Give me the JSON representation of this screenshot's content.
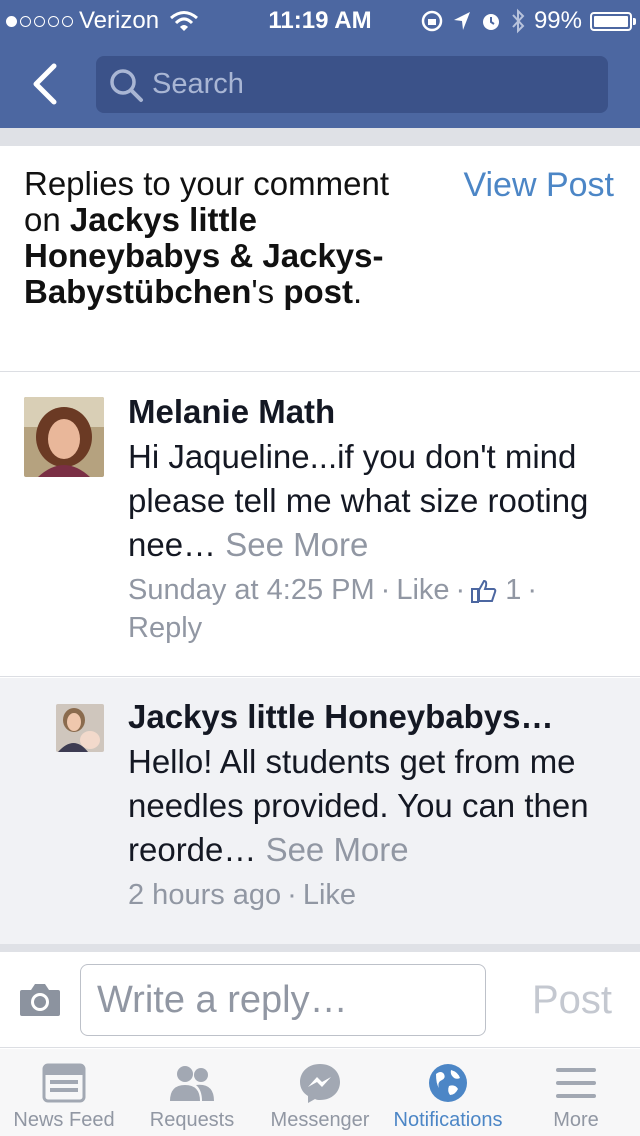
{
  "status_bar": {
    "carrier": "Verizon",
    "signal_dots_filled": 1,
    "signal_dots_total": 5,
    "time": "11:19 AM",
    "battery": "99%",
    "battery_level": 0.99
  },
  "nav": {
    "search_placeholder": "Search"
  },
  "header": {
    "title_part1": "Replies to your comment on ",
    "title_page": "Jackys little Honeybabys & Jackys-Babystübchen",
    "title_part2": "'s ",
    "title_post": "post",
    "title_end": ".",
    "view_post": "View Post"
  },
  "comments": [
    {
      "author": "Melanie Math",
      "text": "Hi Jaqueline...if you don't mind please tell me what size rooting nee… ",
      "see_more": "See More",
      "timestamp": "Sunday at 4:25 PM",
      "like": "Like",
      "like_count": "1",
      "reply": "Reply"
    },
    {
      "author": "Jackys little Honeybabys…",
      "text": "Hello! All students get from me needles provided. You can then reorde… ",
      "see_more": "See More",
      "timestamp": "2 hours ago",
      "like": "Like"
    }
  ],
  "reply_bar": {
    "placeholder": "Write a reply…",
    "post": "Post"
  },
  "tabs": [
    {
      "label": "News Feed",
      "icon": "news-feed-icon",
      "active": false
    },
    {
      "label": "Requests",
      "icon": "friend-requests-icon",
      "active": false
    },
    {
      "label": "Messenger",
      "icon": "messenger-icon",
      "active": false
    },
    {
      "label": "Notifications",
      "icon": "globe-icon",
      "active": true
    },
    {
      "label": "More",
      "icon": "menu-icon",
      "active": false
    }
  ],
  "colors": {
    "brand_blue": "#4c67a1",
    "link_blue": "#4c86c6",
    "secondary_text": "#9197a3"
  }
}
